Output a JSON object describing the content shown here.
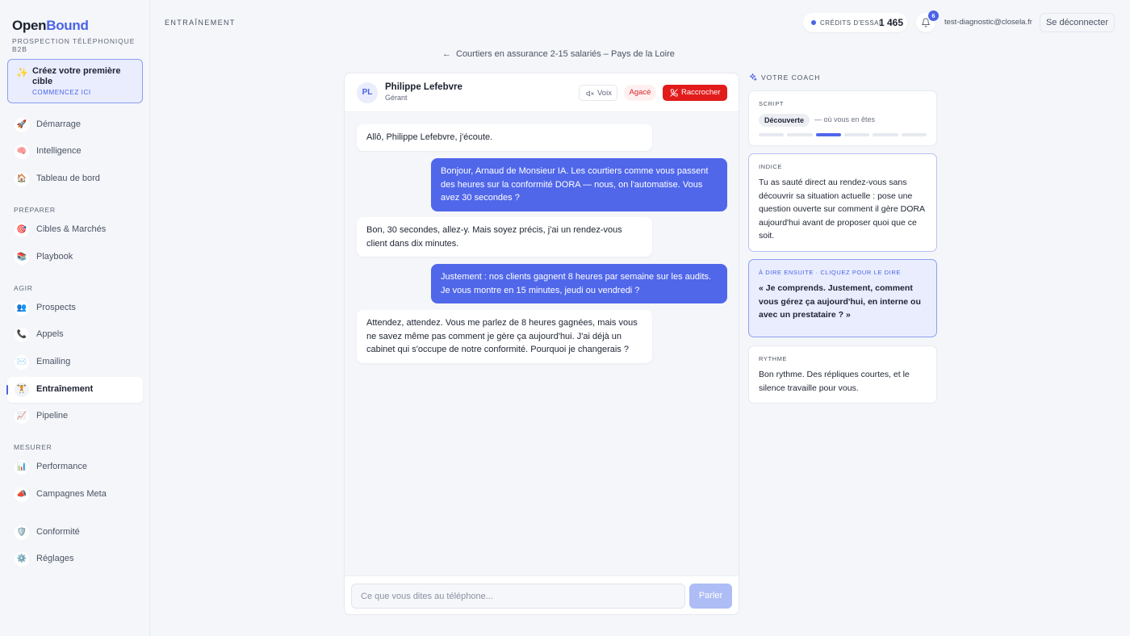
{
  "brand": {
    "name_part1": "Open",
    "name_part2": "Bound",
    "tagline": "Prospection téléphonique B2B"
  },
  "cta": {
    "title": "Créez votre première cible",
    "link": "Commencez ici"
  },
  "nav": {
    "top": [
      {
        "label": "Démarrage",
        "icon": "🚀"
      },
      {
        "label": "Intelligence",
        "icon": "🧠"
      },
      {
        "label": "Tableau de bord",
        "icon": "🏠"
      }
    ],
    "sections": [
      {
        "title": "Préparer",
        "items": [
          {
            "label": "Cibles & Marchés",
            "icon": "🎯"
          },
          {
            "label": "Playbook",
            "icon": "📚"
          }
        ]
      },
      {
        "title": "Agir",
        "items": [
          {
            "label": "Prospects",
            "icon": "👥"
          },
          {
            "label": "Appels",
            "icon": "📞"
          },
          {
            "label": "Emailing",
            "icon": "✉️"
          },
          {
            "label": "Entraînement",
            "icon": "🏋️",
            "active": true
          },
          {
            "label": "Pipeline",
            "icon": "📈"
          }
        ]
      },
      {
        "title": "Mesurer",
        "items": [
          {
            "label": "Performance",
            "icon": "📊"
          },
          {
            "label": "Campagnes Meta",
            "icon": "📣"
          }
        ]
      }
    ],
    "bottom": [
      {
        "label": "Conformité",
        "icon": "🛡️"
      },
      {
        "label": "Réglages",
        "icon": "⚙️"
      }
    ]
  },
  "topbar": {
    "page_label": "Entraînement",
    "credits_label": "Crédits d'essai",
    "credits_value": "1 465",
    "notifications": "6",
    "email": "test-diagnostic@closela.fr",
    "logout": "Se déconnecter"
  },
  "breadcrumb": {
    "back_arrow": "←",
    "title": "Courtiers en assurance 2-15 salariés – Pays de la Loire"
  },
  "call": {
    "initials": "PL",
    "name": "Philippe Lefebvre",
    "role": "Gérant",
    "voice_label": "Voix",
    "mood": "Agacé",
    "hangup_label": "Raccrocher"
  },
  "messages": [
    {
      "from": "them",
      "text": "Allô, Philippe Lefebvre, j'écoute."
    },
    {
      "from": "me",
      "text": "Bonjour, Arnaud de Monsieur IA. Les courtiers comme vous passent des heures sur la conformité DORA — nous, on l'automatise. Vous avez 30 secondes ?"
    },
    {
      "from": "them",
      "text": "Bon, 30 secondes, allez-y. Mais soyez précis, j'ai un rendez-vous client dans dix minutes."
    },
    {
      "from": "me",
      "text": "Justement : nos clients gagnent 8 heures par semaine sur les audits. Je vous montre en 15 minutes, jeudi ou vendredi ?"
    },
    {
      "from": "them",
      "text": "Attendez, attendez. Vous me parlez de 8 heures gagnées, mais vous ne savez même pas comment je gère ça aujourd'hui. J'ai déjà un cabinet qui s'occupe de notre conformité. Pourquoi je changerais ?"
    }
  ],
  "composer": {
    "placeholder": "Ce que vous dites au téléphone...",
    "send_label": "Parler"
  },
  "coach": {
    "title": "Votre coach",
    "script": {
      "label": "Script",
      "stage": "Découverte",
      "note": "— où vous en êtes",
      "steps_total": 6,
      "current_step": 3
    },
    "hint": {
      "label": "Indice",
      "text": "Tu as sauté direct au rendez-vous sans découvrir sa situation actuelle : pose une question ouverte sur comment il gère DORA aujourd'hui avant de proposer quoi que ce soit."
    },
    "next": {
      "label": "À dire ensuite · cliquez pour le dire",
      "text": "« Je comprends. Justement, comment vous gérez ça aujourd'hui, en interne ou avec un prestataire ? »"
    },
    "rhythm": {
      "label": "Rythme",
      "text": "Bon rythme. Des répliques courtes, et le silence travaille pour vous."
    }
  },
  "colors": {
    "accent": "#4a63e6",
    "danger": "#e21b1b",
    "my_bubble": "#5067ea"
  }
}
